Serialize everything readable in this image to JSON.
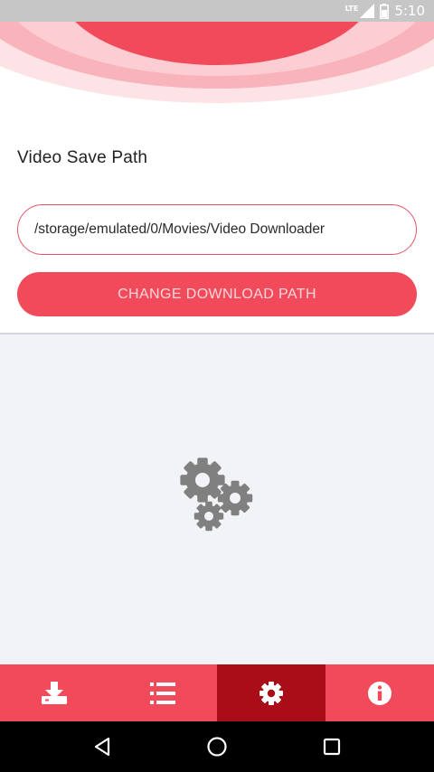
{
  "status_bar": {
    "network_label": "LTE",
    "time": "5:10"
  },
  "settings": {
    "section_title": "Video Save Path",
    "save_path": "/storage/emulated/0/Movies/Video Downloader",
    "change_button_label": "CHANGE DOWNLOAD PATH"
  },
  "bottom_nav": {
    "tabs": [
      {
        "icon": "download-icon",
        "active": false
      },
      {
        "icon": "list-icon",
        "active": false
      },
      {
        "icon": "gear-icon",
        "active": true
      },
      {
        "icon": "info-icon",
        "active": false
      }
    ]
  },
  "system_nav": [
    "back-icon",
    "home-icon",
    "recents-icon"
  ],
  "colors": {
    "accent": "#f14b5b",
    "active_tab": "#a80d18",
    "field_border": "#e35566",
    "gear_gray": "#808080"
  }
}
